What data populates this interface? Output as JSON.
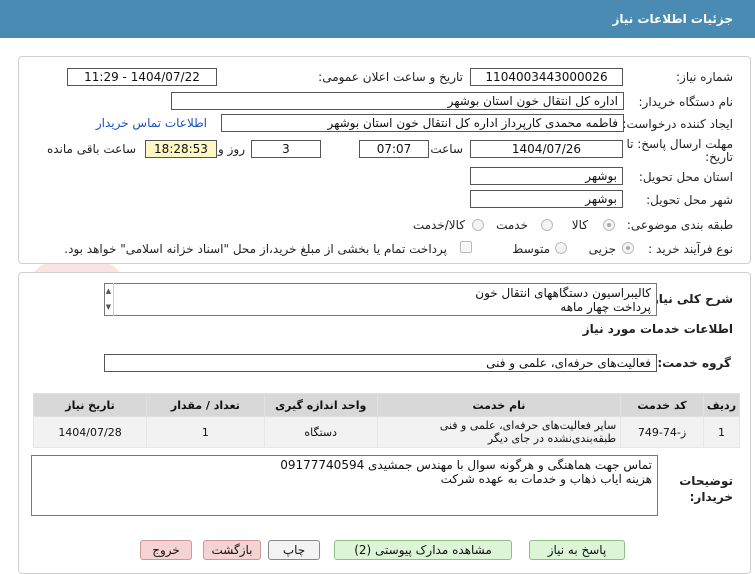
{
  "header": {
    "title": "جزئیات اطلاعات نیاز"
  },
  "fields": {
    "need_number_label": "شماره نیاز:",
    "need_number": "1104003443000026",
    "announce_label": "تاریخ و ساعت اعلان عمومی:",
    "announce_value": "1404/07/22 - 11:29",
    "buyer_org_label": "نام دستگاه خریدار:",
    "buyer_org": "اداره کل انتقال خون استان بوشهر",
    "creator_label": "ایجاد کننده درخواست:",
    "creator": "فاطمه محمدی کارپرداز اداره کل انتقال خون استان بوشهر",
    "contact_link": "اطلاعات تماس خریدار",
    "deadline_label_line1": "مهلت ارسال پاسخ: تا",
    "deadline_label_line2": "تاریخ:",
    "deadline_date": "1404/07/26",
    "time_label": "ساعت",
    "deadline_time": "07:07",
    "days_value": "3",
    "days_label": "روز و",
    "remaining_time": "18:28:53",
    "remaining_label": "ساعت باقی مانده",
    "province_label": "استان محل تحویل:",
    "province": "بوشهر",
    "city_label": "شهر محل تحویل:",
    "city": "بوشهر",
    "category_label": "طبقه بندی موضوعی:",
    "category_options": [
      "کالا",
      "خدمت",
      "کالا/خدمت"
    ],
    "process_label": "نوع فرآیند خرید :",
    "process_options": [
      "جزیی",
      "متوسط"
    ],
    "payment_note": "پرداخت تمام یا بخشی از مبلغ خرید،از محل \"اسناد خزانه اسلامی\" خواهد بود."
  },
  "description": {
    "label": "شرح کلی نیاز:",
    "line1": "کالیبراسیون دستگاههای انتقال خون",
    "line2": "پرداخت چهار ماهه"
  },
  "services": {
    "section_title": "اطلاعات خدمات مورد نیاز",
    "group_label": "گروه خدمت:",
    "group_value": "فعالیت‌های حرفه‌ای، علمی و فنی",
    "columns": [
      "ردیف",
      "کد خدمت",
      "نام خدمت",
      "واحد اندازه گیری",
      "تعداد / مقدار",
      "تاریخ نیاز"
    ],
    "rows": [
      {
        "row": "1",
        "code": "ز-74-749",
        "name": "سایر فعالیت‌های حرفه‌ای، علمی و فنی طبقه‌بندی‌نشده در جای دیگر",
        "unit": "دستگاه",
        "qty": "1",
        "date": "1404/07/28"
      }
    ]
  },
  "buyer_notes": {
    "label_line1": "توضیحات",
    "label_line2": "خریدار:",
    "line1": "تماس جهت هماهنگی و هرگونه سوال با مهندس جمشیدی 09177740594",
    "line2": "هزینه ایاب ذهاب و خدمات به عهده شرکت"
  },
  "buttons": {
    "respond": "پاسخ به نیاز",
    "attachments": "مشاهده مدارک پیوستی (2)",
    "print": "چاپ",
    "back": "بازگشت",
    "exit": "خروج"
  },
  "colors": {
    "header": "#4a8bb3",
    "remaining_bg": "#fdf7c3",
    "link": "#1d53b5"
  }
}
